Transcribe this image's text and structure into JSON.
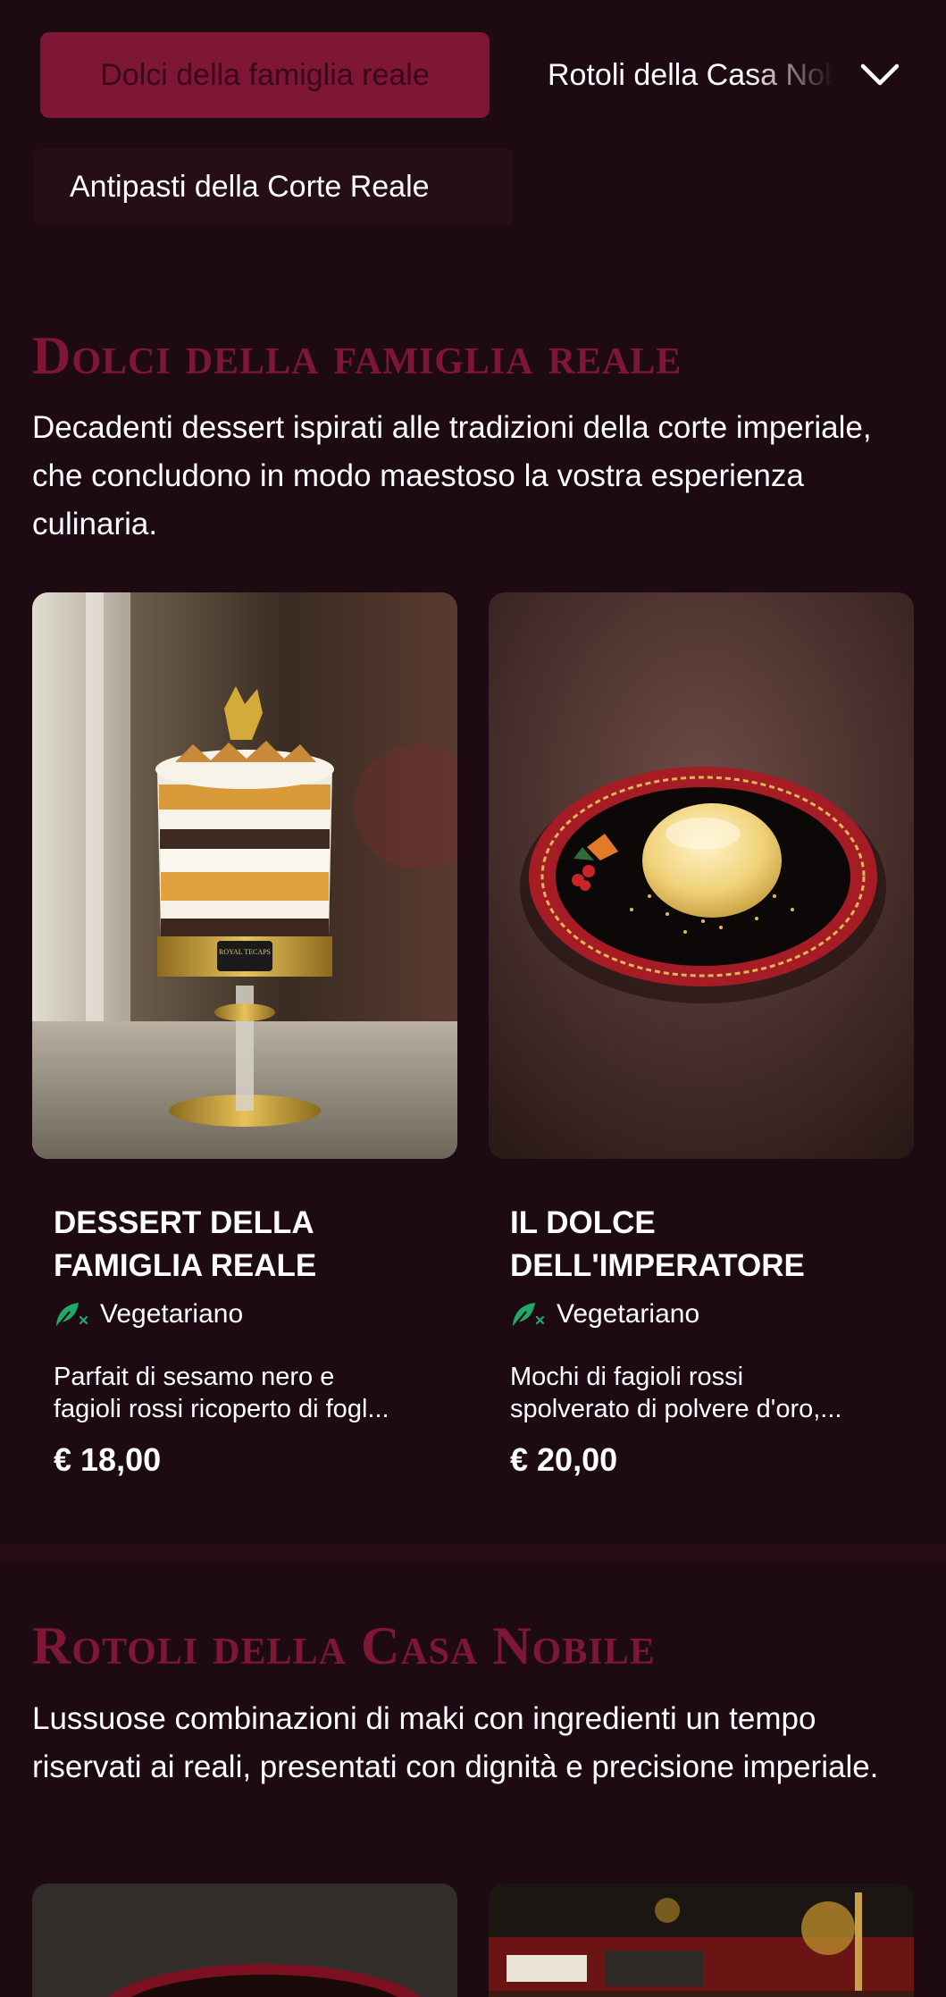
{
  "nav": {
    "categories": [
      {
        "label": "Dolci della famiglia reale",
        "active": true
      },
      {
        "label": "Rotoli della Casa Nobile",
        "active": false
      },
      {
        "label": "Antipasti della Corte Reale",
        "active": false
      }
    ],
    "toggle_icon": "chevron-down-icon"
  },
  "sections": [
    {
      "title": "Dolci della famiglia reale",
      "description": "Decadenti dessert ispirati alle tradizioni della corte imperiale, che concludono in modo maestoso la vostra esperienza culinaria.",
      "items": [
        {
          "name_line1": "DESSERT DELLA",
          "name_line2": "FAMIGLIA REALE",
          "diet": "Vegetariano",
          "diet_icon": "leaf-icon",
          "desc_line1": "Parfait di sesamo nero e",
          "desc_line2": "fagioli rossi ricoperto di fogl...",
          "price": "€ 18,00",
          "image_text": "ROYAL TECAPS"
        },
        {
          "name_line1": "IL DOLCE",
          "name_line2": "DELL'IMPERATORE",
          "diet": "Vegetariano",
          "diet_icon": "leaf-icon",
          "desc_line1": "Mochi di fagioli rossi",
          "desc_line2": "spolverato di polvere d'oro,...",
          "price": "€ 20,00"
        }
      ]
    },
    {
      "title": "Rotoli della Casa Nobile",
      "description": "Lussuose combinazioni di maki con ingredienti un tempo riservati ai reali, presentati con dignità e precisione imperiale."
    }
  ],
  "colors": {
    "background": "#1e0a12",
    "accent": "#7e1635",
    "diet_green": "#1fa86b"
  }
}
